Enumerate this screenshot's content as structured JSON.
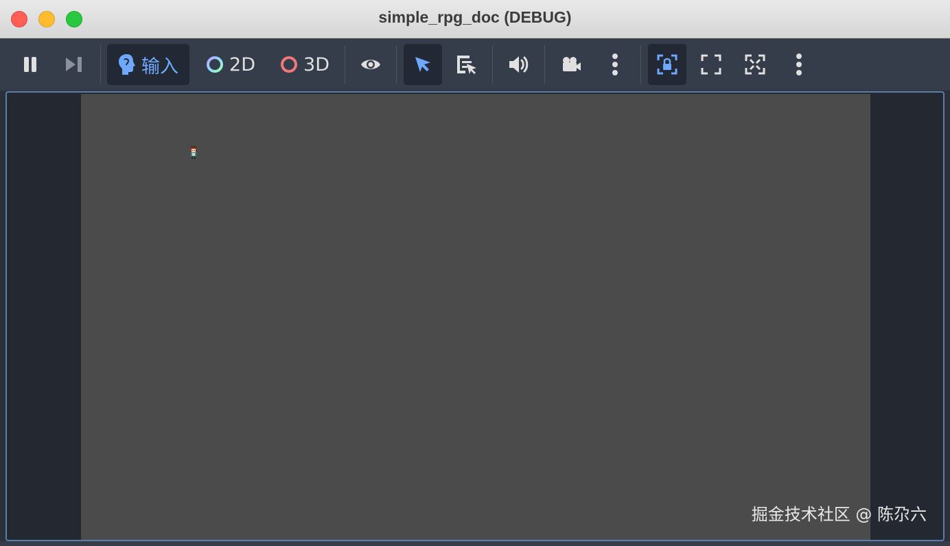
{
  "window": {
    "title": "simple_rpg_doc (DEBUG)"
  },
  "toolbar": {
    "input_label": "输入",
    "label_2d": "2D",
    "label_3d": "3D",
    "colors": {
      "accent": "#6ea9ff",
      "icon": "#e0e0e0",
      "ring_3d": "#f07878"
    }
  },
  "watermark": "掘金技术社区 @ 陈尕六"
}
